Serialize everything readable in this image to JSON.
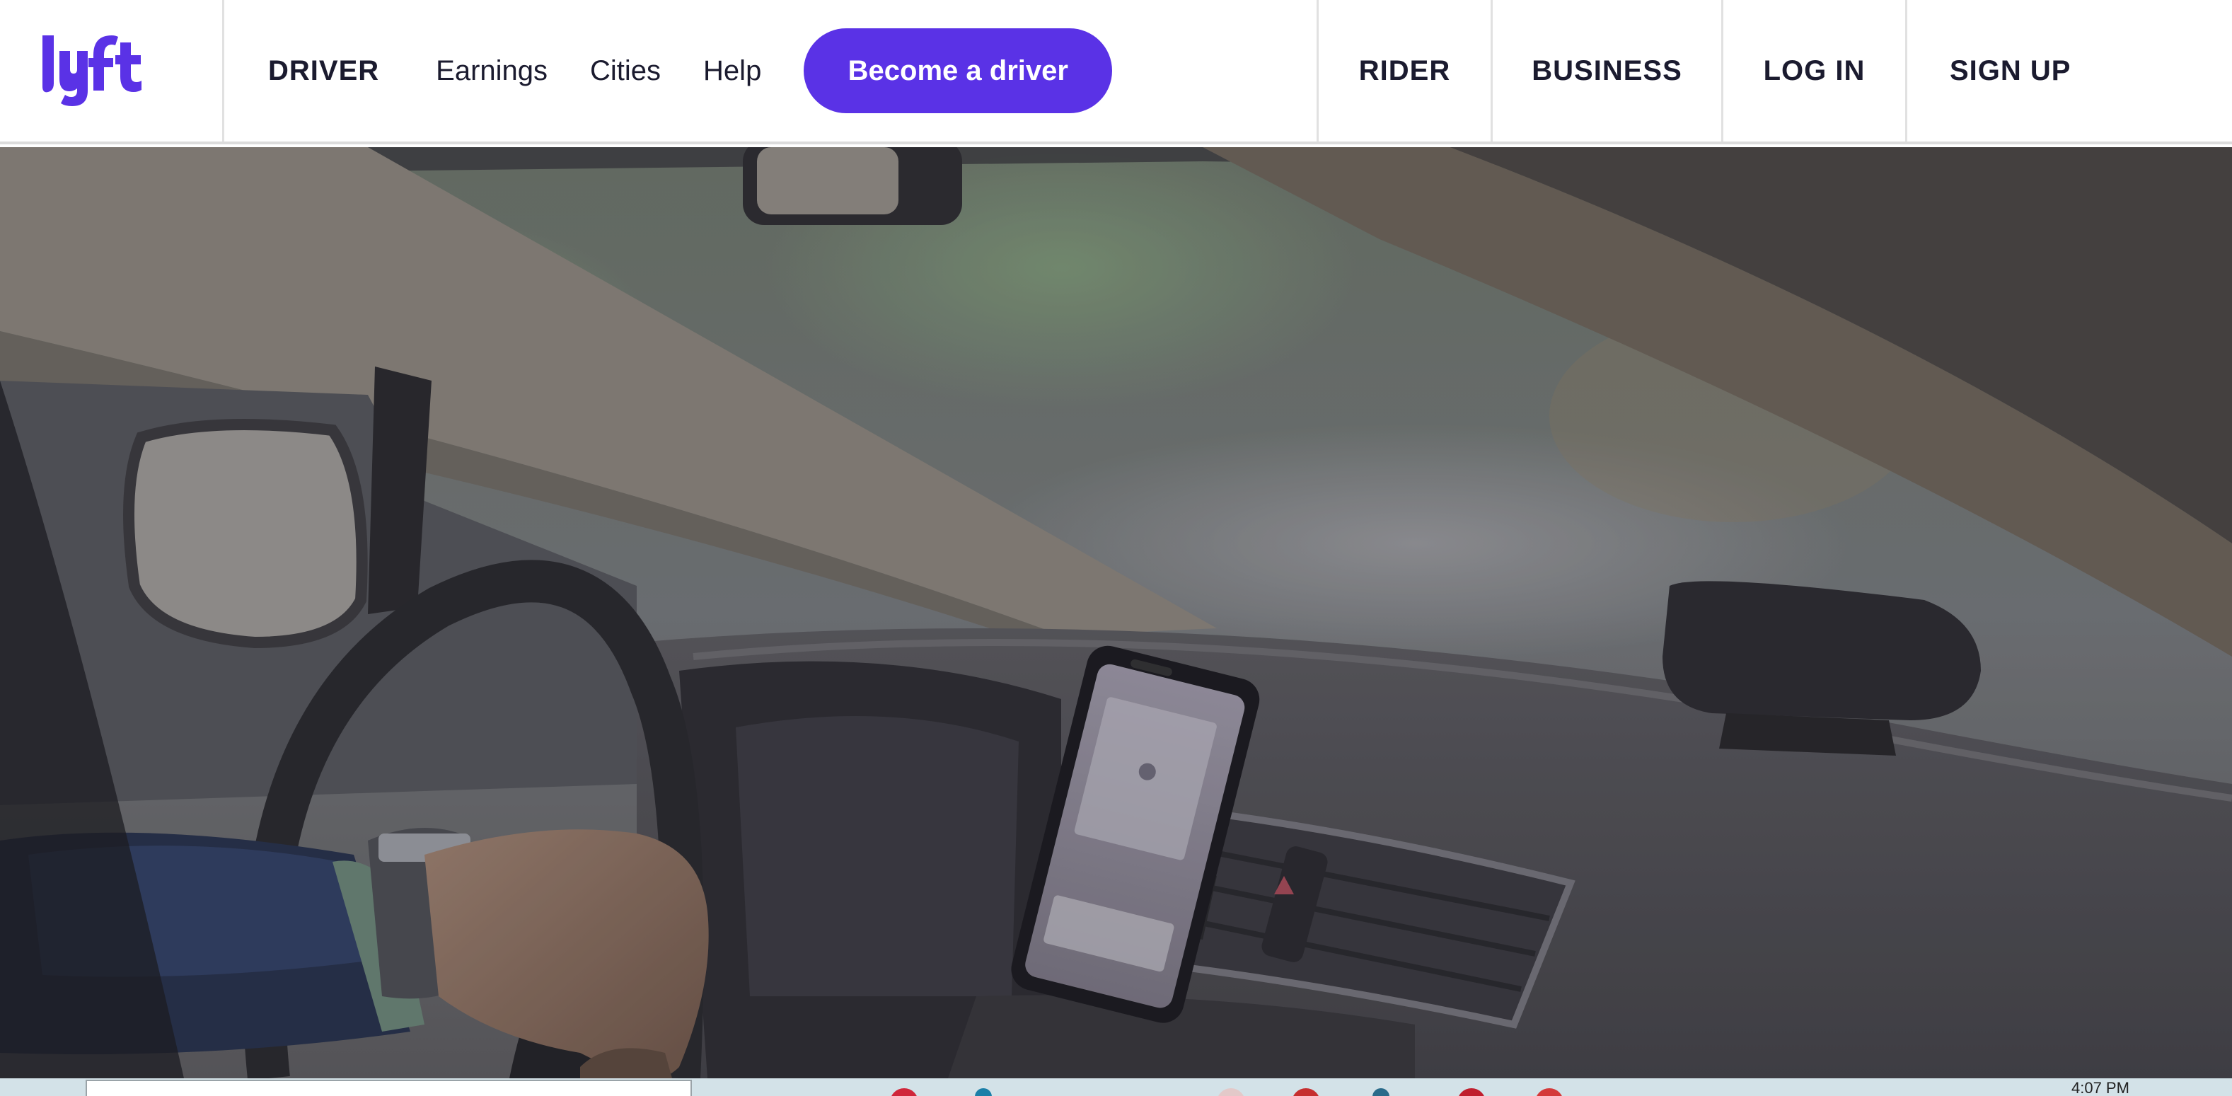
{
  "brand": {
    "logo_text": "lyft",
    "accent": "#5a32e6"
  },
  "nav": {
    "driver": "DRIVER",
    "earnings": "Earnings",
    "cities": "Cities",
    "help": "Help",
    "cta": "Become a driver"
  },
  "nav_right": {
    "rider": "RIDER",
    "business": "BUSINESS",
    "login": "LOG IN",
    "signup": "SIGN UP"
  },
  "taskbar": {
    "clock": "4:07 PM"
  }
}
